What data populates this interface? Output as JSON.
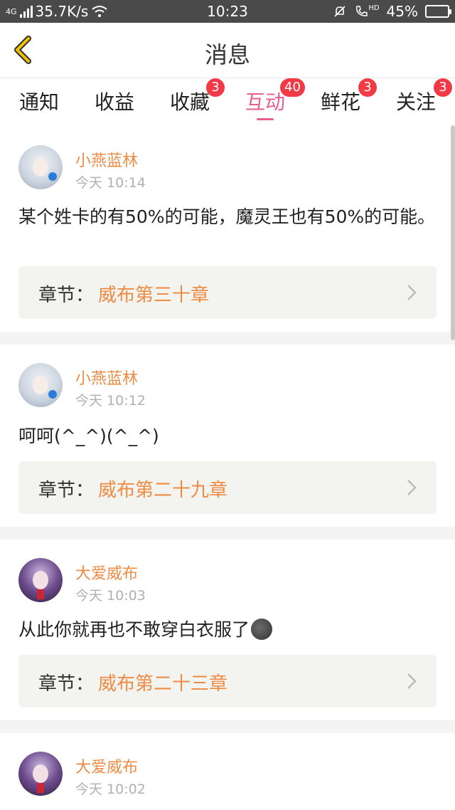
{
  "status_bar": {
    "network": "4G",
    "speed": "35.7K/s",
    "time": "10:23",
    "hd": "HD",
    "battery": "45%",
    "battery_level": 0.45
  },
  "header": {
    "title": "消息"
  },
  "tabs": [
    {
      "label": "通知",
      "badge": ""
    },
    {
      "label": "收益",
      "badge": ""
    },
    {
      "label": "收藏",
      "badge": "3"
    },
    {
      "label": "互动",
      "badge": "40",
      "active": true
    },
    {
      "label": "鲜花",
      "badge": "3"
    },
    {
      "label": "关注",
      "badge": "3"
    }
  ],
  "messages": [
    {
      "user": "小燕蓝林",
      "time": "今天 10:14",
      "content": "某个姓卡的有50%的可能，魔灵王也有50%的可能。",
      "chapter_label": "章节：",
      "chapter": "威布第三十章"
    },
    {
      "user": "小燕蓝林",
      "time": "今天 10:12",
      "content": "呵呵(^_^)(^_^)",
      "chapter_label": "章节：",
      "chapter": "威布第二十九章"
    },
    {
      "user": "大爱威布",
      "time": "今天 10:03",
      "content": "从此你就再也不敢穿白衣服了",
      "chapter_label": "章节：",
      "chapter": "威布第二十三章"
    },
    {
      "user": "大爱威布",
      "time": "今天 10:02"
    }
  ],
  "colors": {
    "accent_pink": "#e65f8e",
    "name_orange": "#ee8b45",
    "badge_red": "#f23a47",
    "back_yellow": "#f2c200"
  }
}
